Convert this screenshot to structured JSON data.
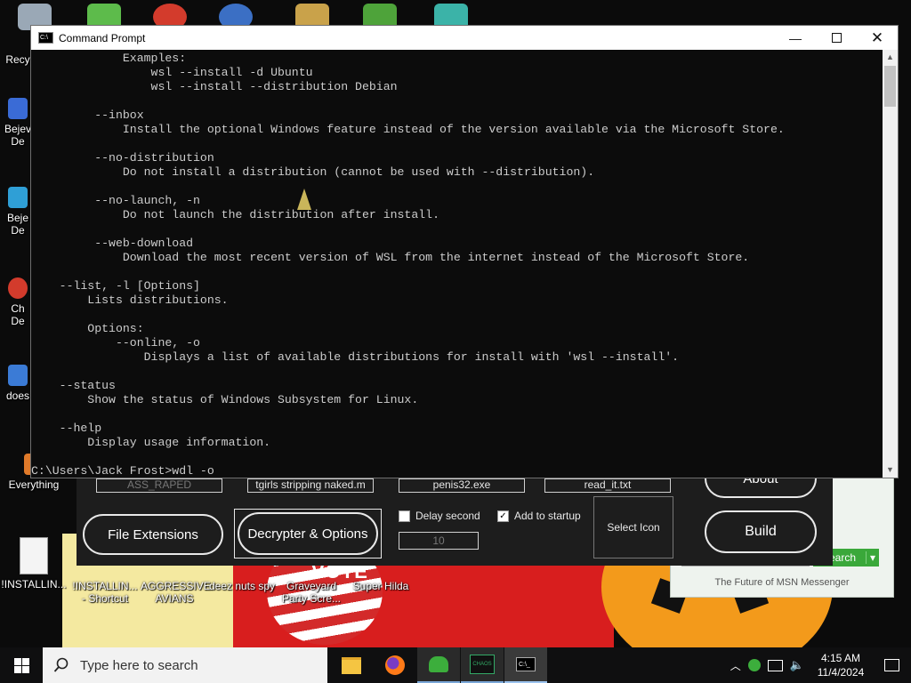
{
  "desktop": {
    "left_icons": [
      {
        "label": "Recy"
      },
      {
        "label": "Bejev\nDe"
      },
      {
        "label": "Beje\nDe"
      },
      {
        "label": "Ch\nDe"
      },
      {
        "label": "does"
      },
      {
        "label": "Everything"
      },
      {
        "label": "!INSTALLIN..."
      }
    ],
    "bottom_icons": [
      {
        "label": "!INSTALLIN...\n- Shortcut"
      },
      {
        "label": "AGGRESSIVE\nAVIANS"
      },
      {
        "label": "deez nuts spy"
      },
      {
        "label": "Graveyard\nParty Scre..."
      },
      {
        "label": "Super Hilda"
      }
    ],
    "wallpaper_text": "VOTE"
  },
  "builder": {
    "fields": [
      "ASS_RAPED",
      "tgirls stripping naked.m",
      "penis32.exe",
      "read_it.txt"
    ],
    "file_extensions_button": "File Extensions",
    "decrypter_button": "Decrypter & Options",
    "delay_label": "Delay second",
    "delay_value": "10",
    "startup_label": "Add to startup",
    "select_icon_label": "Select Icon",
    "about_button": "About",
    "build_button": "Build"
  },
  "msn": {
    "search_button": "earch",
    "tagline": "The Future of MSN Messenger"
  },
  "cmd_window": {
    "title": "Command Prompt",
    "lines": [
      "             Examples:",
      "                 wsl --install -d Ubuntu",
      "                 wsl --install --distribution Debian",
      "",
      "         --inbox",
      "             Install the optional Windows feature instead of the version available via the Microsoft Store.",
      "",
      "         --no-distribution",
      "             Do not install a distribution (cannot be used with --distribution).",
      "",
      "         --no-launch, -n",
      "             Do not launch the distribution after install.",
      "",
      "         --web-download",
      "             Download the most recent version of WSL from the internet instead of the Microsoft Store.",
      "",
      "    --list, -l [Options]",
      "        Lists distributions.",
      "",
      "        Options:",
      "            --online, -o",
      "                Displays a list of available distributions for install with 'wsl --install'.",
      "",
      "    --status",
      "        Show the status of Windows Subsystem for Linux.",
      "",
      "    --help",
      "        Display usage information.",
      "",
      "C:\\Users\\Jack Frost>wdl -o"
    ]
  },
  "taskbar": {
    "search_placeholder": "Type here to search",
    "time": "4:15 AM",
    "date": "11/4/2024",
    "apps": [
      "file-explorer",
      "firefox",
      "msn-messenger",
      "chaos-app",
      "command-prompt"
    ]
  },
  "colors": {
    "console_bg": "#0c0c0c",
    "console_text": "#cccccc",
    "taskbar_bg": "#0f0f10",
    "builder_bg": "#1d1d1d",
    "msn_green": "#3aa83a"
  }
}
